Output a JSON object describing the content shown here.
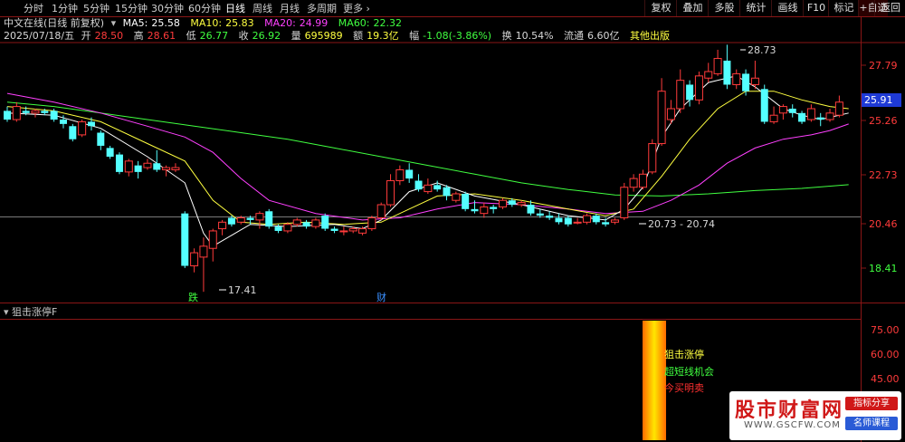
{
  "toolbar": {
    "periods": [
      {
        "label": "分时",
        "active": false
      },
      {
        "label": "1分钟",
        "active": false
      },
      {
        "label": "5分钟",
        "active": false
      },
      {
        "label": "15分钟",
        "active": false
      },
      {
        "label": "30分钟",
        "active": false
      },
      {
        "label": "60分钟",
        "active": false
      },
      {
        "label": "日线",
        "active": true
      },
      {
        "label": "周线",
        "active": false
      },
      {
        "label": "月线",
        "active": false
      },
      {
        "label": "多周期",
        "active": false
      },
      {
        "label": "更多",
        "active": false
      }
    ],
    "buttons": [
      "复权",
      "叠加",
      "多股",
      "统计",
      "画线",
      "F10",
      "标记",
      "+自选",
      "返回"
    ]
  },
  "header": {
    "title": "中文在线(日线 前复权)",
    "ma": [
      {
        "label": "MA5:",
        "value": "25.58",
        "color": "#ffffff"
      },
      {
        "label": "MA10:",
        "value": "25.83",
        "color": "#ffff40"
      },
      {
        "label": "MA20:",
        "value": "24.99",
        "color": "#ff40ff"
      },
      {
        "label": "MA60:",
        "value": "22.32",
        "color": "#40ff40"
      }
    ],
    "quote": {
      "date": "2025/07/18/五",
      "open_label": "开",
      "open": "28.50",
      "high_label": "高",
      "high": "28.61",
      "low_label": "低",
      "low": "26.77",
      "close_label": "收",
      "close": "26.92",
      "vol_label": "量",
      "vol": "695989",
      "amount_label": "额",
      "amount": "19.3亿",
      "change_label": "幅",
      "change": "-1.08(-3.86%)",
      "turnover_label": "换",
      "turnover": "10.54%",
      "float_label": "流通",
      "float": "6.60亿",
      "extra": "其他出版"
    }
  },
  "price_axis": {
    "labels": [
      "27.79",
      "25.26",
      "22.73",
      "20.46",
      "18.41"
    ],
    "current": "25.91"
  },
  "annotations": {
    "high": "28.73",
    "low": "17.41",
    "range": "20.73 - 20.74",
    "marker_fall": "跌",
    "marker_cai": "财"
  },
  "indicator": {
    "title": "狙击涨停F",
    "axis_labels": [
      "75.00",
      "60.00",
      "45.00"
    ],
    "labels": [
      {
        "text": "狙击涨停",
        "color": "#ffff40"
      },
      {
        "text": "超短线机会",
        "color": "#40ff40"
      },
      {
        "text": "今买明卖",
        "color": "#ff3030"
      }
    ]
  },
  "colors": {
    "up": "#ff3b3b",
    "down": "#54ffff",
    "ma5": "#ffffff",
    "ma10": "#ffff40",
    "ma20": "#ff40ff",
    "ma60": "#40ff40"
  },
  "watermark": {
    "main": "股市财富网",
    "url": "WWW.GSCFW.COM",
    "tag1": "指标分享",
    "tag2": "名师课程"
  },
  "chart_data": {
    "type": "candlestick",
    "ylim": [
      17.0,
      29.5
    ],
    "candles": [
      {
        "o": 25.7,
        "c": 25.3,
        "h": 25.9,
        "l": 25.2
      },
      {
        "o": 25.3,
        "c": 25.9,
        "h": 26.1,
        "l": 25.2
      },
      {
        "o": 25.7,
        "c": 25.6,
        "h": 25.9,
        "l": 25.5
      },
      {
        "o": 25.6,
        "c": 25.7,
        "h": 25.8,
        "l": 25.4
      },
      {
        "o": 25.7,
        "c": 25.6,
        "h": 25.8,
        "l": 25.5
      },
      {
        "o": 25.7,
        "c": 25.3,
        "h": 25.8,
        "l": 25.2
      },
      {
        "o": 25.3,
        "c": 25.1,
        "h": 25.5,
        "l": 24.9
      },
      {
        "o": 25.0,
        "c": 24.4,
        "h": 25.1,
        "l": 24.3
      },
      {
        "o": 24.6,
        "c": 25.2,
        "h": 25.3,
        "l": 24.5
      },
      {
        "o": 25.2,
        "c": 25.0,
        "h": 25.4,
        "l": 24.8
      },
      {
        "o": 24.7,
        "c": 24.1,
        "h": 24.8,
        "l": 23.9
      },
      {
        "o": 24.0,
        "c": 23.6,
        "h": 24.1,
        "l": 23.5
      },
      {
        "o": 23.7,
        "c": 22.9,
        "h": 23.8,
        "l": 22.8
      },
      {
        "o": 22.9,
        "c": 23.4,
        "h": 23.5,
        "l": 22.7
      },
      {
        "o": 23.2,
        "c": 22.9,
        "h": 23.4,
        "l": 22.6
      },
      {
        "o": 23.1,
        "c": 23.3,
        "h": 23.5,
        "l": 23.0
      },
      {
        "o": 23.3,
        "c": 23.0,
        "h": 23.9,
        "l": 22.9
      },
      {
        "o": 23.0,
        "c": 23.1,
        "h": 23.2,
        "l": 22.7
      },
      {
        "o": 23.0,
        "c": 23.1,
        "h": 23.3,
        "l": 22.9
      },
      {
        "o": 21.0,
        "c": 18.6,
        "h": 21.1,
        "l": 18.5
      },
      {
        "o": 18.6,
        "c": 19.2,
        "h": 19.4,
        "l": 18.3
      },
      {
        "o": 19.0,
        "c": 19.5,
        "h": 19.9,
        "l": 17.41
      },
      {
        "o": 19.4,
        "c": 20.2,
        "h": 20.3,
        "l": 18.8
      },
      {
        "o": 20.3,
        "c": 20.6,
        "h": 20.7,
        "l": 20.0
      },
      {
        "o": 20.8,
        "c": 20.5,
        "h": 20.9,
        "l": 20.4
      },
      {
        "o": 20.6,
        "c": 20.8,
        "h": 20.9,
        "l": 20.5
      },
      {
        "o": 20.8,
        "c": 20.7,
        "h": 20.9,
        "l": 20.5
      },
      {
        "o": 20.7,
        "c": 21.0,
        "h": 21.1,
        "l": 20.3
      },
      {
        "o": 21.1,
        "c": 20.4,
        "h": 21.2,
        "l": 20.3
      },
      {
        "o": 20.4,
        "c": 20.2,
        "h": 20.5,
        "l": 20.1
      },
      {
        "o": 20.2,
        "c": 20.5,
        "h": 20.6,
        "l": 20.1
      },
      {
        "o": 20.5,
        "c": 20.7,
        "h": 20.8,
        "l": 20.4
      },
      {
        "o": 20.6,
        "c": 20.4,
        "h": 20.7,
        "l": 20.3
      },
      {
        "o": 20.4,
        "c": 20.7,
        "h": 20.8,
        "l": 20.3
      },
      {
        "o": 20.9,
        "c": 20.3,
        "h": 21.0,
        "l": 20.2
      },
      {
        "o": 20.3,
        "c": 20.2,
        "h": 20.4,
        "l": 20.1
      },
      {
        "o": 20.2,
        "c": 20.2,
        "h": 20.4,
        "l": 20.0
      },
      {
        "o": 20.2,
        "c": 20.3,
        "h": 20.4,
        "l": 20.1
      },
      {
        "o": 20.1,
        "c": 20.3,
        "h": 20.4,
        "l": 20.0
      },
      {
        "o": 20.3,
        "c": 20.8,
        "h": 20.9,
        "l": 20.2
      },
      {
        "o": 20.8,
        "c": 21.4,
        "h": 21.5,
        "l": 20.7
      },
      {
        "o": 21.4,
        "c": 22.5,
        "h": 22.8,
        "l": 21.3
      },
      {
        "o": 22.5,
        "c": 23.0,
        "h": 23.2,
        "l": 22.3
      },
      {
        "o": 23.0,
        "c": 22.6,
        "h": 23.3,
        "l": 22.4
      },
      {
        "o": 22.5,
        "c": 22.1,
        "h": 22.8,
        "l": 22.0
      },
      {
        "o": 22.0,
        "c": 22.3,
        "h": 22.6,
        "l": 21.9
      },
      {
        "o": 22.3,
        "c": 22.1,
        "h": 22.5,
        "l": 22.0
      },
      {
        "o": 22.2,
        "c": 21.8,
        "h": 22.3,
        "l": 21.6
      },
      {
        "o": 21.6,
        "c": 21.9,
        "h": 22.0,
        "l": 21.5
      },
      {
        "o": 21.9,
        "c": 21.2,
        "h": 22.0,
        "l": 21.1
      },
      {
        "o": 21.2,
        "c": 21.1,
        "h": 21.6,
        "l": 21.0
      },
      {
        "o": 21.0,
        "c": 21.3,
        "h": 21.5,
        "l": 20.8
      },
      {
        "o": 21.3,
        "c": 21.2,
        "h": 21.4,
        "l": 21.0
      },
      {
        "o": 21.3,
        "c": 21.6,
        "h": 21.7,
        "l": 21.2
      },
      {
        "o": 21.6,
        "c": 21.4,
        "h": 21.7,
        "l": 21.3
      },
      {
        "o": 21.4,
        "c": 21.5,
        "h": 21.6,
        "l": 21.3
      },
      {
        "o": 21.4,
        "c": 21.0,
        "h": 21.6,
        "l": 20.9
      },
      {
        "o": 21.0,
        "c": 20.9,
        "h": 21.2,
        "l": 20.8
      },
      {
        "o": 20.9,
        "c": 20.8,
        "h": 21.1,
        "l": 20.7
      },
      {
        "o": 20.8,
        "c": 20.6,
        "h": 21.0,
        "l": 20.5
      },
      {
        "o": 20.8,
        "c": 20.5,
        "h": 20.9,
        "l": 20.4
      },
      {
        "o": 20.6,
        "c": 20.6,
        "h": 20.8,
        "l": 20.5
      },
      {
        "o": 20.6,
        "c": 20.9,
        "h": 21.0,
        "l": 20.5
      },
      {
        "o": 20.9,
        "c": 20.6,
        "h": 21.0,
        "l": 20.5
      },
      {
        "o": 20.6,
        "c": 20.5,
        "h": 20.8,
        "l": 20.4
      },
      {
        "o": 20.6,
        "c": 20.7,
        "h": 20.8,
        "l": 20.5
      },
      {
        "o": 20.8,
        "c": 22.2,
        "h": 22.4,
        "l": 20.7
      },
      {
        "o": 22.2,
        "c": 22.6,
        "h": 22.8,
        "l": 22.0
      },
      {
        "o": 22.2,
        "c": 22.8,
        "h": 23.0,
        "l": 22.1
      },
      {
        "o": 22.9,
        "c": 24.2,
        "h": 24.4,
        "l": 22.8
      },
      {
        "o": 24.2,
        "c": 26.6,
        "h": 27.2,
        "l": 24.1
      },
      {
        "o": 25.3,
        "c": 25.8,
        "h": 26.2,
        "l": 25.1
      },
      {
        "o": 25.8,
        "c": 27.1,
        "h": 27.6,
        "l": 25.6
      },
      {
        "o": 26.9,
        "c": 26.2,
        "h": 27.1,
        "l": 25.9
      },
      {
        "o": 26.2,
        "c": 27.3,
        "h": 27.5,
        "l": 26.0
      },
      {
        "o": 27.2,
        "c": 27.5,
        "h": 27.9,
        "l": 27.0
      },
      {
        "o": 27.4,
        "c": 28.1,
        "h": 28.5,
        "l": 27.3
      },
      {
        "o": 28.0,
        "c": 26.9,
        "h": 28.73,
        "l": 26.7
      },
      {
        "o": 26.9,
        "c": 27.4,
        "h": 27.6,
        "l": 26.7
      },
      {
        "o": 27.4,
        "c": 26.6,
        "h": 27.6,
        "l": 26.4
      },
      {
        "o": 26.9,
        "c": 27.2,
        "h": 28.0,
        "l": 26.7
      },
      {
        "o": 26.7,
        "c": 25.2,
        "h": 26.9,
        "l": 25.1
      },
      {
        "o": 25.2,
        "c": 25.5,
        "h": 25.9,
        "l": 25.1
      },
      {
        "o": 25.6,
        "c": 25.9,
        "h": 26.0,
        "l": 25.3
      },
      {
        "o": 25.8,
        "c": 25.6,
        "h": 26.0,
        "l": 25.4
      },
      {
        "o": 25.6,
        "c": 25.2,
        "h": 25.7,
        "l": 25.1
      },
      {
        "o": 25.3,
        "c": 25.8,
        "h": 26.0,
        "l": 25.2
      },
      {
        "o": 25.4,
        "c": 25.3,
        "h": 25.6,
        "l": 25.0
      },
      {
        "o": 25.3,
        "c": 25.6,
        "h": 25.8,
        "l": 25.2
      },
      {
        "o": 25.5,
        "c": 26.1,
        "h": 26.4,
        "l": 25.4
      }
    ],
    "ma5": [
      [
        0,
        25.6
      ],
      [
        5,
        25.5
      ],
      [
        10,
        24.9
      ],
      [
        15,
        23.6
      ],
      [
        19,
        22.4
      ],
      [
        21,
        20.1
      ],
      [
        22,
        19.5
      ],
      [
        24,
        20.0
      ],
      [
        26,
        20.5
      ],
      [
        30,
        20.4
      ],
      [
        35,
        20.5
      ],
      [
        38,
        20.3
      ],
      [
        40,
        20.7
      ],
      [
        43,
        22.0
      ],
      [
        46,
        22.4
      ],
      [
        50,
        21.8
      ],
      [
        55,
        21.4
      ],
      [
        60,
        20.9
      ],
      [
        64,
        20.7
      ],
      [
        66,
        21.2
      ],
      [
        68,
        22.2
      ],
      [
        70,
        24.5
      ],
      [
        72,
        25.8
      ],
      [
        75,
        27.0
      ],
      [
        78,
        27.3
      ],
      [
        80,
        26.8
      ],
      [
        83,
        25.8
      ],
      [
        85,
        25.5
      ],
      [
        87,
        25.3
      ],
      [
        90,
        25.6
      ]
    ],
    "ma10": [
      [
        0,
        25.9
      ],
      [
        5,
        25.7
      ],
      [
        10,
        25.2
      ],
      [
        15,
        24.2
      ],
      [
        19,
        23.4
      ],
      [
        22,
        21.6
      ],
      [
        25,
        20.6
      ],
      [
        28,
        20.5
      ],
      [
        32,
        20.6
      ],
      [
        36,
        20.5
      ],
      [
        40,
        20.6
      ],
      [
        43,
        21.2
      ],
      [
        46,
        21.8
      ],
      [
        50,
        21.9
      ],
      [
        55,
        21.6
      ],
      [
        60,
        21.2
      ],
      [
        64,
        20.9
      ],
      [
        67,
        21.2
      ],
      [
        70,
        22.7
      ],
      [
        73,
        24.4
      ],
      [
        76,
        25.8
      ],
      [
        79,
        26.6
      ],
      [
        82,
        26.6
      ],
      [
        85,
        26.2
      ],
      [
        88,
        25.9
      ],
      [
        90,
        25.8
      ]
    ],
    "ma20": [
      [
        0,
        26.5
      ],
      [
        5,
        26.1
      ],
      [
        10,
        25.6
      ],
      [
        15,
        25.0
      ],
      [
        19,
        24.5
      ],
      [
        22,
        23.8
      ],
      [
        25,
        22.6
      ],
      [
        28,
        21.6
      ],
      [
        33,
        21.0
      ],
      [
        38,
        20.7
      ],
      [
        42,
        20.8
      ],
      [
        46,
        21.2
      ],
      [
        50,
        21.5
      ],
      [
        55,
        21.4
      ],
      [
        60,
        21.2
      ],
      [
        64,
        21.0
      ],
      [
        68,
        21.1
      ],
      [
        71,
        21.6
      ],
      [
        74,
        22.3
      ],
      [
        77,
        23.3
      ],
      [
        80,
        24.0
      ],
      [
        83,
        24.4
      ],
      [
        86,
        24.6
      ],
      [
        88,
        24.8
      ],
      [
        90,
        25.1
      ]
    ],
    "ma60": [
      [
        0,
        26.1
      ],
      [
        5,
        25.9
      ],
      [
        10,
        25.6
      ],
      [
        15,
        25.3
      ],
      [
        20,
        25.0
      ],
      [
        25,
        24.7
      ],
      [
        30,
        24.4
      ],
      [
        35,
        24.0
      ],
      [
        40,
        23.6
      ],
      [
        45,
        23.2
      ],
      [
        50,
        22.8
      ],
      [
        55,
        22.4
      ],
      [
        60,
        22.1
      ],
      [
        65,
        21.85
      ],
      [
        70,
        21.8
      ],
      [
        75,
        21.9
      ],
      [
        80,
        22.05
      ],
      [
        85,
        22.15
      ],
      [
        90,
        22.32
      ]
    ]
  }
}
